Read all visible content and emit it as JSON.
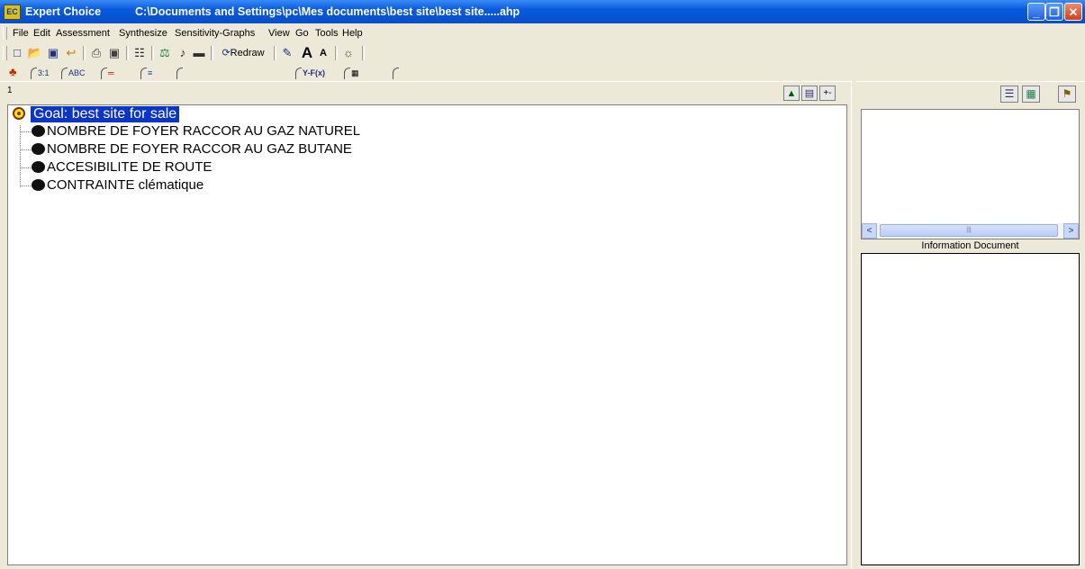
{
  "window": {
    "app_title": "Expert Choice",
    "file_path": "C:\\Documents and Settings\\pc\\Mes documents\\best site\\best site.....ahp",
    "app_icon_text": "EC",
    "minimize": "_",
    "restore": "❐",
    "close": "✕"
  },
  "menu": [
    {
      "label": "File"
    },
    {
      "label": "Edit"
    },
    {
      "label": "Assessment"
    },
    {
      "label": "Synthesize"
    },
    {
      "label": "Sensitivity-Graphs"
    },
    {
      "label": "View"
    },
    {
      "label": "Go"
    },
    {
      "label": "Tools"
    },
    {
      "label": "Help"
    }
  ],
  "toolbar": {
    "redraw_label": "Redraw",
    "icons": [
      "new-file-icon",
      "open-folder-icon",
      "save-disk-icon",
      "undo-icon",
      "print-icon",
      "print-preview-icon",
      "hierarchy-icon",
      "balance-scale-icon",
      "music-note-icon",
      "block-icon",
      "redraw-icon",
      "pencil-icon",
      "font-larger-icon",
      "font-smaller-icon",
      "help-icon"
    ]
  },
  "mode_tabs": {
    "items": [
      {
        "label": "3:1"
      },
      {
        "label": "ABC"
      },
      {
        "label": "═"
      },
      {
        "label": "≡"
      },
      {
        "label": ""
      },
      {
        "label": "Y-F(x)"
      },
      {
        "label": "▦"
      }
    ]
  },
  "tree": {
    "level_number": "1",
    "goal": "Goal: best site for sale",
    "criteria": [
      {
        "label": "NOMBRE DE FOYER RACCOR AU GAZ NATUREL"
      },
      {
        "label": "NOMBRE DE FOYER RACCOR AU GAZ BUTANE"
      },
      {
        "label": "ACCESIBILITE DE ROUTE"
      },
      {
        "label": "CONTRAINTE clématique"
      }
    ]
  },
  "info_panel": {
    "label": "Information Document",
    "scroll_left": "<",
    "scroll_right": ">"
  },
  "colors": {
    "titlebar_blue": "#0a5ae0",
    "goal_highlight": "#0a35c8",
    "window_bg": "#ece9d8"
  }
}
